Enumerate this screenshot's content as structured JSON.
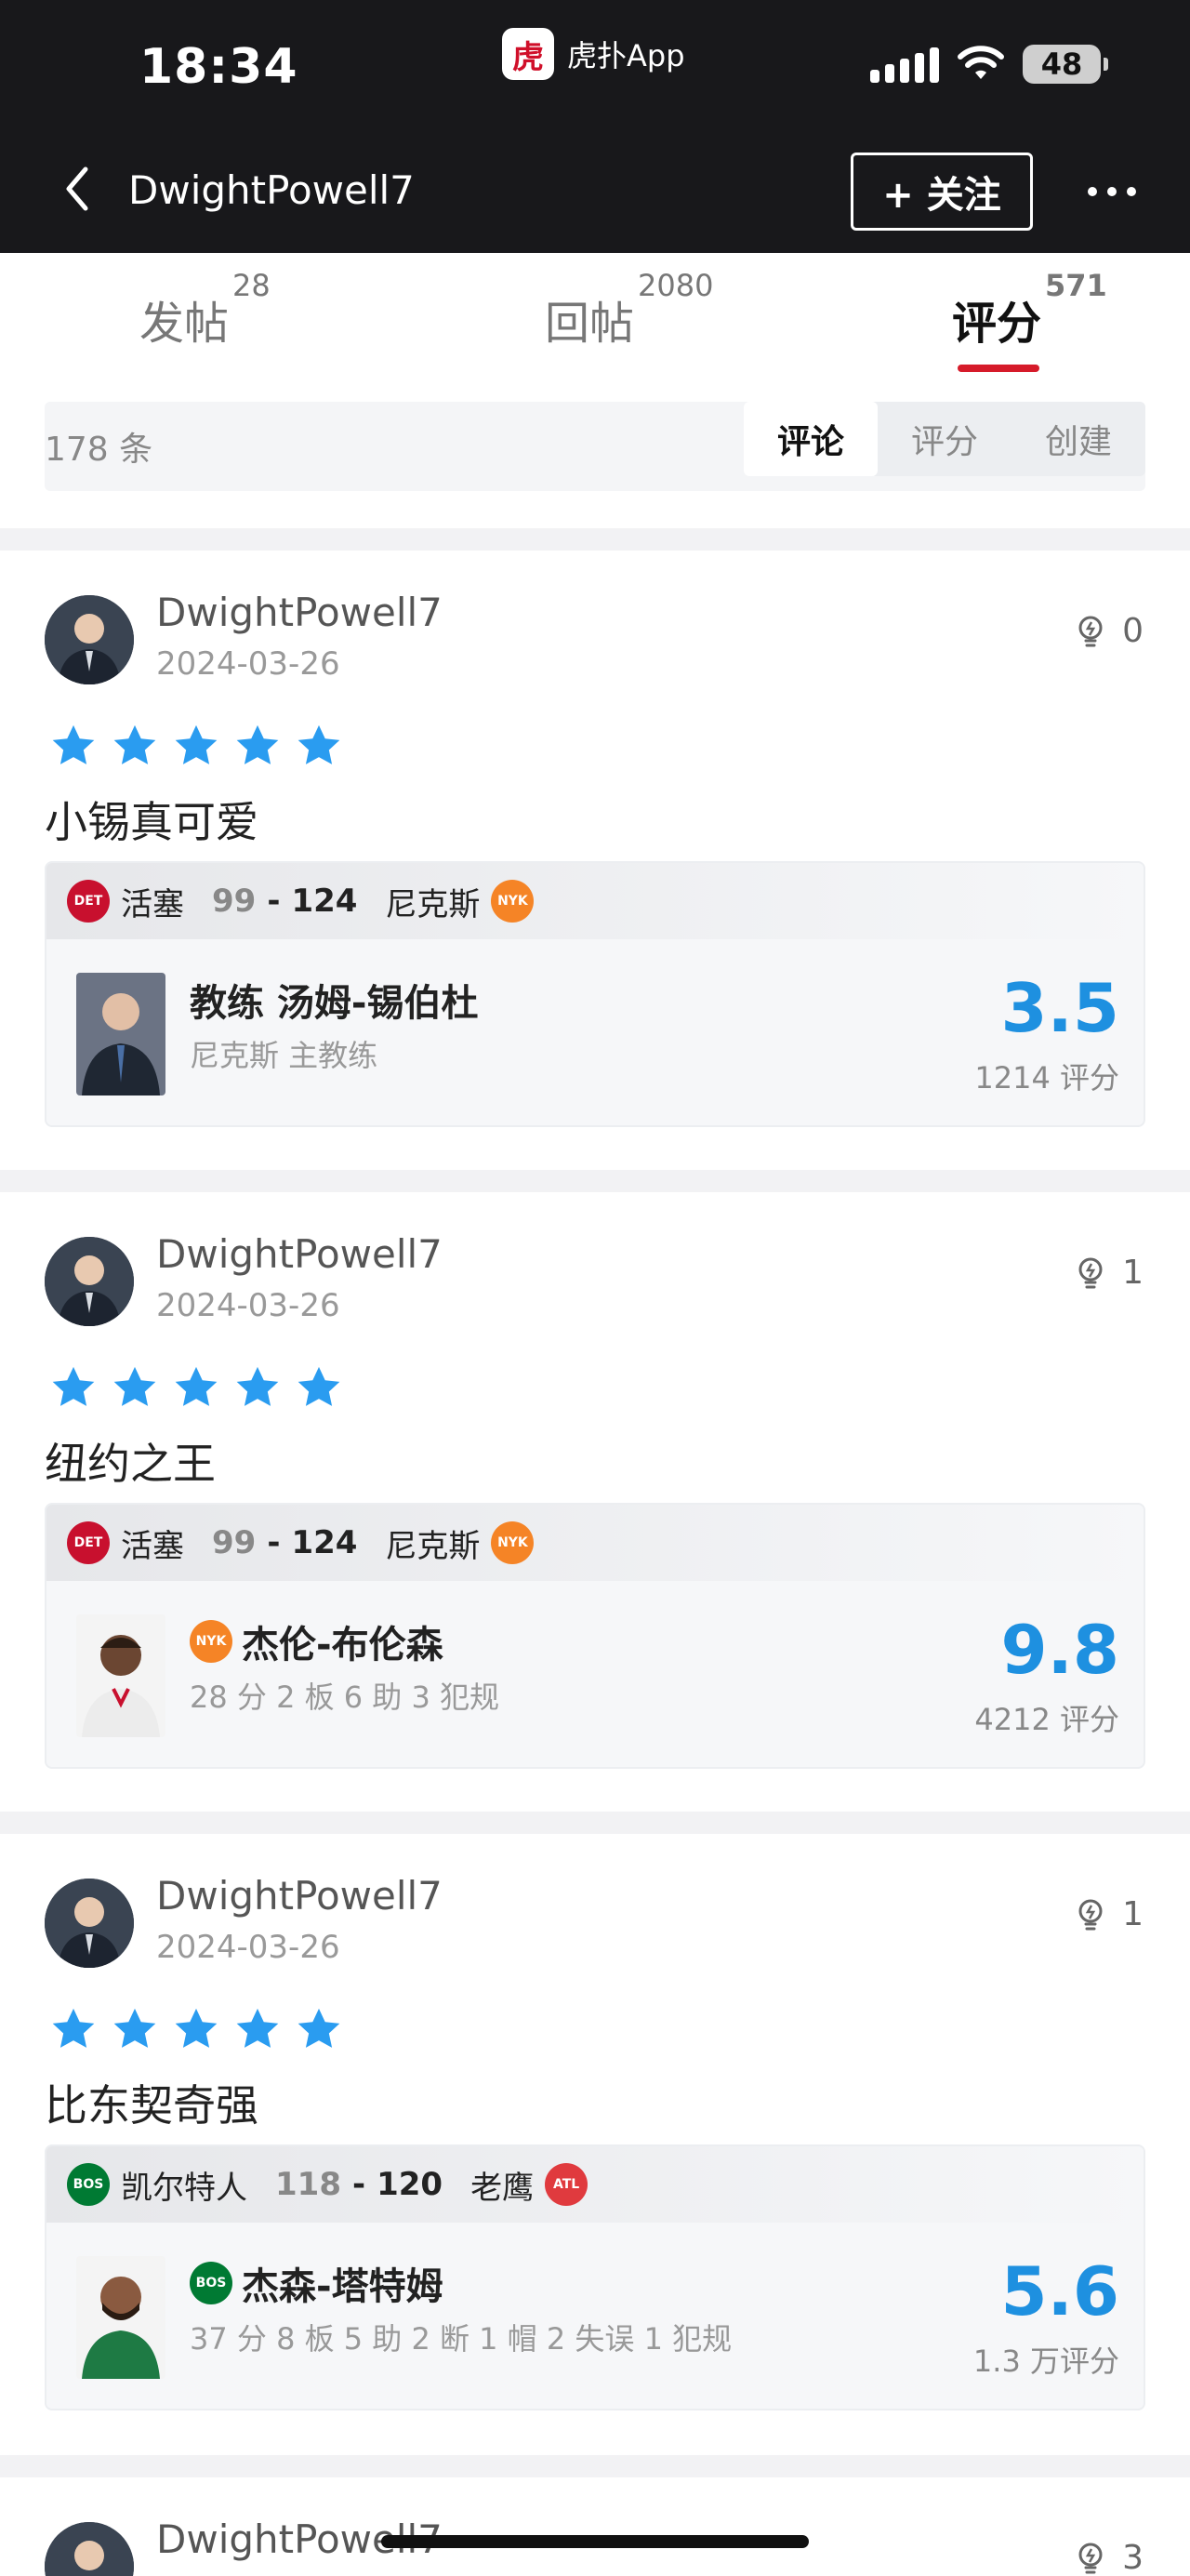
{
  "status_bar": {
    "time": "18:34",
    "app_name": "虎扑App",
    "app_logo_text": "虎",
    "battery": "48"
  },
  "nav": {
    "title": "DwightPowell7",
    "follow_label": "+ 关注"
  },
  "tabs": [
    {
      "label": "发帖",
      "count": "28"
    },
    {
      "label": "回帖",
      "count": "2080"
    },
    {
      "label": "评分",
      "count": "571"
    }
  ],
  "filter": {
    "count_label": "178 条",
    "segments": [
      "评论",
      "评分",
      "创建"
    ],
    "active_segment": "评论"
  },
  "reviews": [
    {
      "username": "DwightPowell7",
      "date": "2024-03-26",
      "likes": "0",
      "stars": 5,
      "comment": "小锡真可爱",
      "game": {
        "team_a": "活塞",
        "team_a_logo": "DET",
        "score_a": "99",
        "sep": "-",
        "score_b": "124",
        "team_b": "尼克斯",
        "team_b_logo": "NYK"
      },
      "subject": {
        "name": "教练 汤姆-锡伯杜",
        "team_logo": "",
        "sub": "尼克斯 主教练",
        "rating": "3.5",
        "rating_count": "1214 评分"
      }
    },
    {
      "username": "DwightPowell7",
      "date": "2024-03-26",
      "likes": "1",
      "stars": 5,
      "comment": "纽约之王",
      "game": {
        "team_a": "活塞",
        "team_a_logo": "DET",
        "score_a": "99",
        "sep": "-",
        "score_b": "124",
        "team_b": "尼克斯",
        "team_b_logo": "NYK"
      },
      "subject": {
        "name": "杰伦-布伦森",
        "team_logo": "NYK",
        "sub": "28 分 2 板 6 助 3 犯规",
        "rating": "9.8",
        "rating_count": "4212 评分"
      }
    },
    {
      "username": "DwightPowell7",
      "date": "2024-03-26",
      "likes": "1",
      "stars": 5,
      "comment": "比东契奇强",
      "game": {
        "team_a": "凯尔特人",
        "team_a_logo": "BOS",
        "score_a": "118",
        "sep": "-",
        "score_b": "120",
        "team_b": "老鹰",
        "team_b_logo": "ATL"
      },
      "subject": {
        "name": "杰森-塔特姆",
        "team_logo": "BOS",
        "sub": "37 分 8 板 5 助 2 断 1 帽 2 失误 1 犯规",
        "rating": "5.6",
        "rating_count": "1.3 万评分"
      }
    },
    {
      "username": "DwightPowell7",
      "likes": "3"
    }
  ],
  "colors": {
    "accent_red": "#d61b2a",
    "rating_blue": "#1e90e0",
    "star_blue": "#2a9cf0",
    "det": "#c8102e",
    "nyk": "#f58426",
    "bos": "#007a33",
    "atl": "#e03a3e"
  }
}
